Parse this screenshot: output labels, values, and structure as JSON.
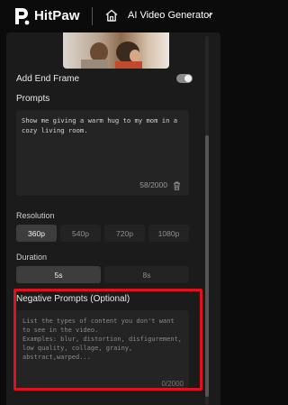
{
  "header": {
    "brand": "HitPaw",
    "app_title": "AI Video Generator"
  },
  "form": {
    "end_frame_label": "Add End Frame",
    "end_frame_enabled": false,
    "prompts_label": "Prompts",
    "prompt_value": "Show me giving a warm hug to my mom in a cozy living room.",
    "prompt_count": "58/2000",
    "resolution_label": "Resolution",
    "resolutions": [
      "360p",
      "540p",
      "720p",
      "1080p"
    ],
    "resolution_selected": "360p",
    "duration_label": "Duration",
    "durations": [
      "5s",
      "8s"
    ],
    "duration_selected": "5s",
    "negative_label": "Negative Prompts (Optional)",
    "negative_placeholder": "List the types of content you don't want to see in the video.\nExamples: blur, distortion, disfigurement, low quality, collage, grainy,  abstract,warped...",
    "negative_count": "0/2000"
  },
  "colors": {
    "highlight": "#e0121f",
    "panel": "#1b1b1b",
    "selected_button": "#3d3d3d"
  }
}
